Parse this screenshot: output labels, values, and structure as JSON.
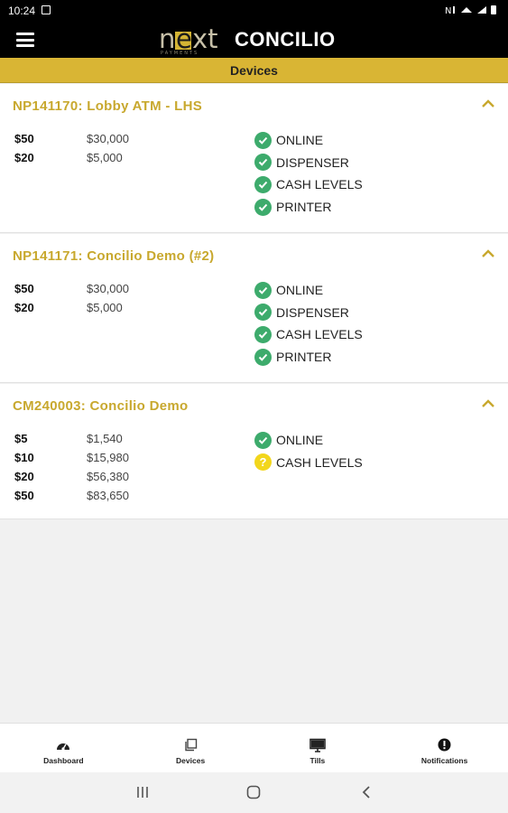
{
  "statusbar": {
    "time": "10:24",
    "right_icons": "N ⚬ ▼ ▮"
  },
  "appbar": {
    "logo_next": "next",
    "logo_brand": "CONCILIO"
  },
  "page": {
    "title": "Devices"
  },
  "devices": [
    {
      "name": "NP141170: Lobby ATM - LHS",
      "denominations": [
        {
          "denom": "$50",
          "amount": "$30,000"
        },
        {
          "denom": "$20",
          "amount": "$5,000"
        }
      ],
      "statuses": [
        {
          "label": "ONLINE",
          "state": "ok"
        },
        {
          "label": "DISPENSER",
          "state": "ok"
        },
        {
          "label": "CASH LEVELS",
          "state": "ok"
        },
        {
          "label": "PRINTER",
          "state": "ok"
        }
      ]
    },
    {
      "name": "NP141171: Concilio Demo (#2)",
      "denominations": [
        {
          "denom": "$50",
          "amount": "$30,000"
        },
        {
          "denom": "$20",
          "amount": "$5,000"
        }
      ],
      "statuses": [
        {
          "label": "ONLINE",
          "state": "ok"
        },
        {
          "label": "DISPENSER",
          "state": "ok"
        },
        {
          "label": "CASH LEVELS",
          "state": "ok"
        },
        {
          "label": "PRINTER",
          "state": "ok"
        }
      ]
    },
    {
      "name": "CM240003: Concilio Demo",
      "denominations": [
        {
          "denom": "$5",
          "amount": "$1,540"
        },
        {
          "denom": "$10",
          "amount": "$15,980"
        },
        {
          "denom": "$20",
          "amount": "$56,380"
        },
        {
          "denom": "$50",
          "amount": "$83,650"
        }
      ],
      "statuses": [
        {
          "label": "ONLINE",
          "state": "ok"
        },
        {
          "label": "CASH LEVELS",
          "state": "warning"
        }
      ]
    }
  ],
  "bottomnav": [
    {
      "label": "Dashboard",
      "icon": "dashboard-icon"
    },
    {
      "label": "Devices",
      "icon": "devices-icon"
    },
    {
      "label": "Tills",
      "icon": "monitor-icon"
    },
    {
      "label": "Notifications",
      "icon": "alert-icon"
    }
  ],
  "colors": {
    "accent": "#d9b534",
    "title_text": "#c8a82e",
    "ok": "#3dab6c",
    "warning": "#f2d61c"
  }
}
